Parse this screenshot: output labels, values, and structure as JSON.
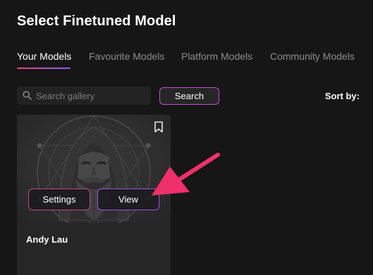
{
  "page": {
    "title": "Select Finetuned Model"
  },
  "tabs": [
    {
      "label": "Your Models",
      "active": true
    },
    {
      "label": "Favourite Models",
      "active": false
    },
    {
      "label": "Platform Models",
      "active": false
    },
    {
      "label": "Community Models",
      "active": false
    }
  ],
  "search": {
    "placeholder": "Search gallery",
    "value": "",
    "button_label": "Search",
    "icon": "search-icon"
  },
  "sort": {
    "label": "Sort by:"
  },
  "cards": [
    {
      "name": "Andy Lau",
      "settings_label": "Settings",
      "view_label": "View",
      "bookmark_icon": "bookmark-icon",
      "image": "bearded-man-portrait"
    }
  ],
  "annotation": {
    "icon": "arrow-pointer-icon",
    "color": "#f0306a"
  },
  "colors": {
    "background": "#161616",
    "accent_pink": "#e8457a",
    "accent_purple": "#8a5cf6"
  }
}
